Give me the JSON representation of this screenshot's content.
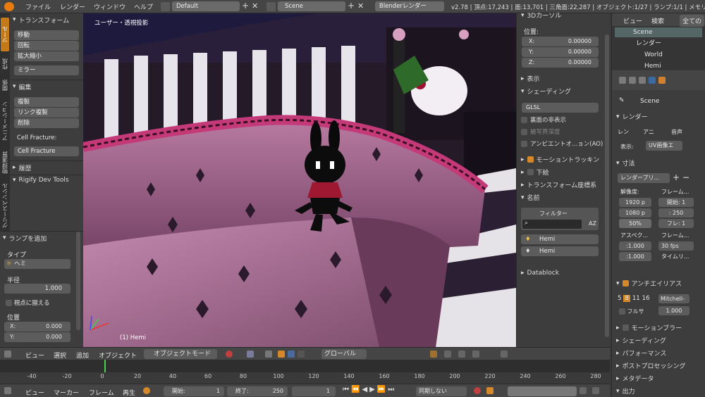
{
  "topbar": {
    "menu": [
      "ファイル",
      "レンダー",
      "ウィンドウ",
      "ヘルプ"
    ],
    "layout": "Default",
    "scene": "Scene",
    "engine": "Blenderレンダー",
    "stats": "v2.78 | 頂点:17,243 | 面:13,701 | 三角面:22,287 | オブジェクト:1/27 | ランプ:1/1 | メモリ"
  },
  "tabs": [
    "ツール",
    "作成",
    "関係",
    "アニメーション",
    "物理演算",
    "グリースペンシル"
  ],
  "tools": {
    "transform_header": "トランスフォーム",
    "move": "移動",
    "rotate": "回転",
    "scale": "拡大縮小",
    "mirror": "ミラー",
    "edit_header": "編集",
    "duplicate": "複製",
    "duplicate_linked": "リンク複製",
    "delete": "削除",
    "cell_fracture_label": "Cell Fracture:",
    "cell_fracture": "Cell Fracture",
    "history": "履歴",
    "rigify": "Rigify Dev Tools"
  },
  "lamp": {
    "header": "ランプを追加",
    "type_label": "タイプ",
    "type_value": "ヘミ",
    "radius_label": "半径",
    "radius_value": "1.000",
    "align_label": "視点に揃える",
    "location_label": "位置",
    "x": "0.000",
    "y": "0.000"
  },
  "viewport": {
    "title": "ユーザー・透視投影",
    "object_label": "(1) Hemi"
  },
  "npanel": {
    "cursor_header": "3Dカーソル",
    "location_label": "位置:",
    "x_label": "X:",
    "x": "0.00000",
    "y_label": "Y:",
    "y": "0.00000",
    "z_label": "Z:",
    "z": "0.00000",
    "display": "表示",
    "shading": "シェーディング",
    "shading_mode": "GLSL",
    "backface": "裏面の非表示",
    "depth": "被写界深度",
    "ao": "アンビエントオ...ョン(AO)",
    "motion_tracking": "モーショントラッキン",
    "background": "下絵",
    "transform_orient": "トランスフォーム座標系",
    "name": "名前",
    "filter": "フィルター",
    "item1": "Hemi",
    "item2": "Hemi",
    "datablock": "Datablock"
  },
  "outliner": {
    "menu_view": "ビュー",
    "menu_search": "検索",
    "menu_all": "全ての",
    "items": [
      "Scene",
      "レンダー",
      "World",
      "Hemi"
    ]
  },
  "props": {
    "scene": "Scene",
    "render_header": "レンダー",
    "render_btn": "レン",
    "anim_btn": "アニ",
    "audio_btn": "音声",
    "display_label": "表示:",
    "display_value": "UV画像エ",
    "dimensions": "寸法",
    "preset": "レンダープリ...",
    "resolution": "解像度:",
    "res_x": "1920 p",
    "res_y": "1080 p",
    "res_pct": "50%",
    "frame_range": "フレーム...",
    "start": "開始: 1",
    "end": ": 250",
    "step": "フレ: 1",
    "aspect": "アスペク...",
    "aspect_x": ":1.000",
    "aspect_y": ":1.000",
    "frame_rate": "フレーム...",
    "fps": "30 fps",
    "timemap": "タイムリ...",
    "antialias": "アンチエイリアス",
    "aa_5": "5",
    "aa_8": "8",
    "aa_11": "11",
    "aa_16": "16",
    "aa_filter": "Mitchell-",
    "full_sample": "フルサ",
    "full_value": "1.000",
    "motion_blur": "モーションブラー",
    "shading": "シェーディング",
    "performance": "パフォーマンス",
    "postproc": "ポストプロセッシング",
    "metadata": "メタデータ",
    "output": "出力"
  },
  "vpheader": {
    "view": "ビュー",
    "select": "選択",
    "add": "追加",
    "object": "オブジェクト",
    "mode": "オブジェクトモード",
    "orientation": "グローバル"
  },
  "timeline": {
    "ticks": [
      "-40",
      "-20",
      "0",
      "20",
      "40",
      "60",
      "80",
      "100",
      "120",
      "140",
      "160",
      "180",
      "200",
      "220",
      "240",
      "260",
      "280"
    ],
    "current_frame": 1
  },
  "tlheader": {
    "view": "ビュー",
    "marker": "マーカー",
    "frame": "フレーム",
    "playback": "再生",
    "start": "開始:",
    "start_val": "1",
    "end": "終了:",
    "end_val": "250",
    "current": "1",
    "sync": "同期しない"
  }
}
